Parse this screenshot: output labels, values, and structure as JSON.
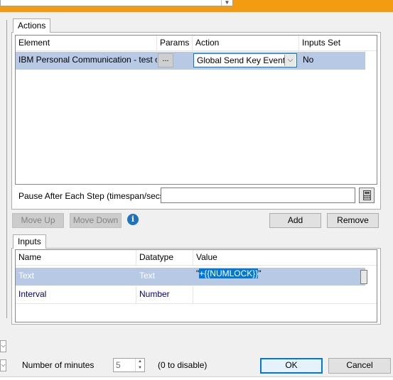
{
  "actions": {
    "tab_label": "Actions",
    "columns": [
      "Element",
      "Params",
      "Action",
      "Inputs Set"
    ],
    "row": {
      "element": "IBM Personal Communication - test object",
      "params": "...",
      "action": "Global  Send  Key Event",
      "inputs_set": "No"
    },
    "pause_label": "Pause After Each Step (timespan/secs)",
    "pause_value": ""
  },
  "buttons": {
    "move_up": "Move Up",
    "move_down": "Move Down",
    "add": "Add",
    "remove": "Remove",
    "ok": "OK",
    "cancel": "Cancel"
  },
  "inputs": {
    "tab_label": "Inputs",
    "columns": [
      "Name",
      "Datatype",
      "Value"
    ],
    "rows": [
      {
        "name": "Text",
        "datatype": "Text",
        "value_prefix": "\"",
        "value_selected": "+{{NUMLOCK}}",
        "value_suffix": "\""
      },
      {
        "name": "Interval",
        "datatype": "Number",
        "value": ""
      }
    ]
  },
  "footer": {
    "minutes_label": "Number of minutes",
    "minutes_value": "5",
    "disable_hint": "(0 to disable)"
  },
  "icons": {
    "info": "info-icon",
    "calculator": "calculator-icon",
    "dropdown": "chevron-down-icon"
  },
  "colors": {
    "top_strip": "#f39c12",
    "selected_row": "#b8c9e6",
    "highlight": "#0078d7",
    "link_text": "#00007f"
  }
}
